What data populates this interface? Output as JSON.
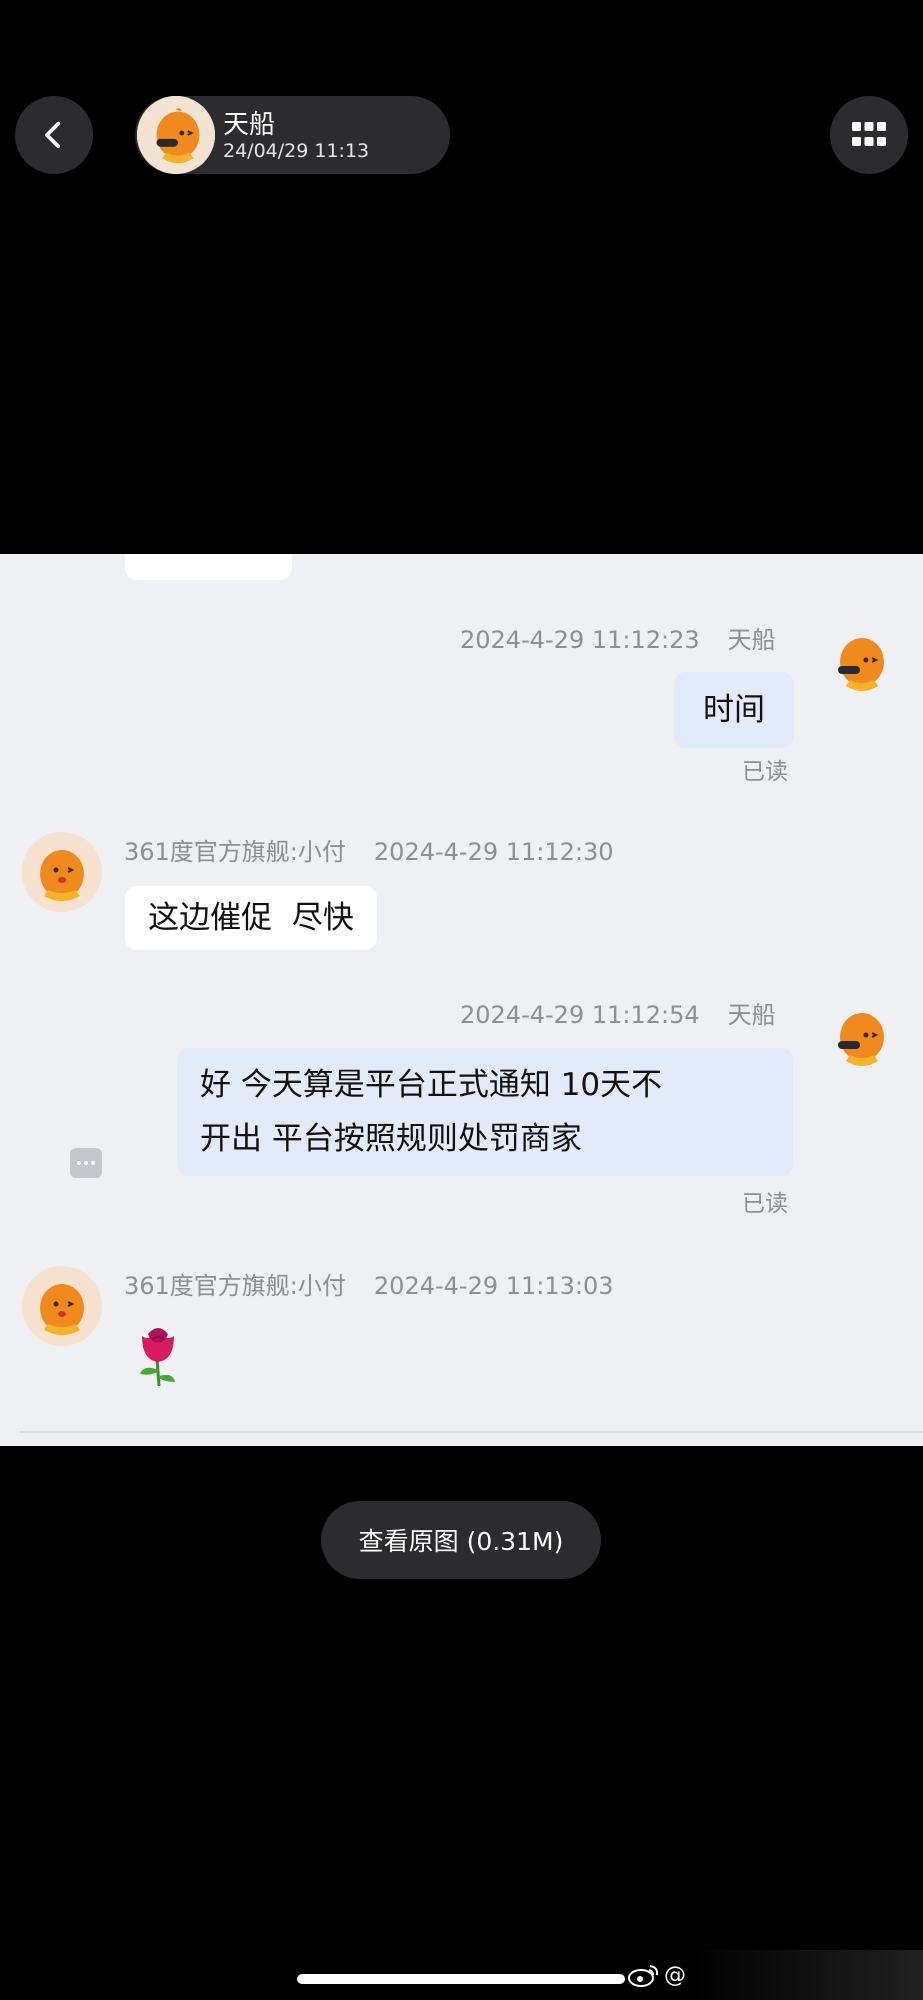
{
  "header": {
    "contact_name": "天船",
    "contact_time": "24/04/29 11:13"
  },
  "messages": [
    {
      "sender": "天船",
      "timestamp": "2024-4-29 11:12:23",
      "text": "时间",
      "status": "已读",
      "side": "right"
    },
    {
      "sender": "361度官方旗舰:小付",
      "timestamp": "2024-4-29 11:12:30",
      "text": "这边催促  尽快",
      "side": "left"
    },
    {
      "sender": "天船",
      "timestamp": "2024-4-29 11:12:54",
      "text_line1": "好 今天算是平台正式通知 10天不",
      "text_line2": "开出 平台按照规则处罚商家",
      "status": "已读",
      "side": "right"
    },
    {
      "sender": "361度官方旗舰:小付",
      "timestamp": "2024-4-29 11:13:03",
      "emoji": "🌹",
      "side": "left"
    }
  ],
  "view_original_label": "查看原图 (0.31M)",
  "watermark_text": "@",
  "colors": {
    "background": "#000000",
    "chat_bg": "#eff0f3",
    "my_bubble": "#e3ebfb",
    "their_bubble": "#ffffff",
    "meta_text": "#8e8e93"
  }
}
